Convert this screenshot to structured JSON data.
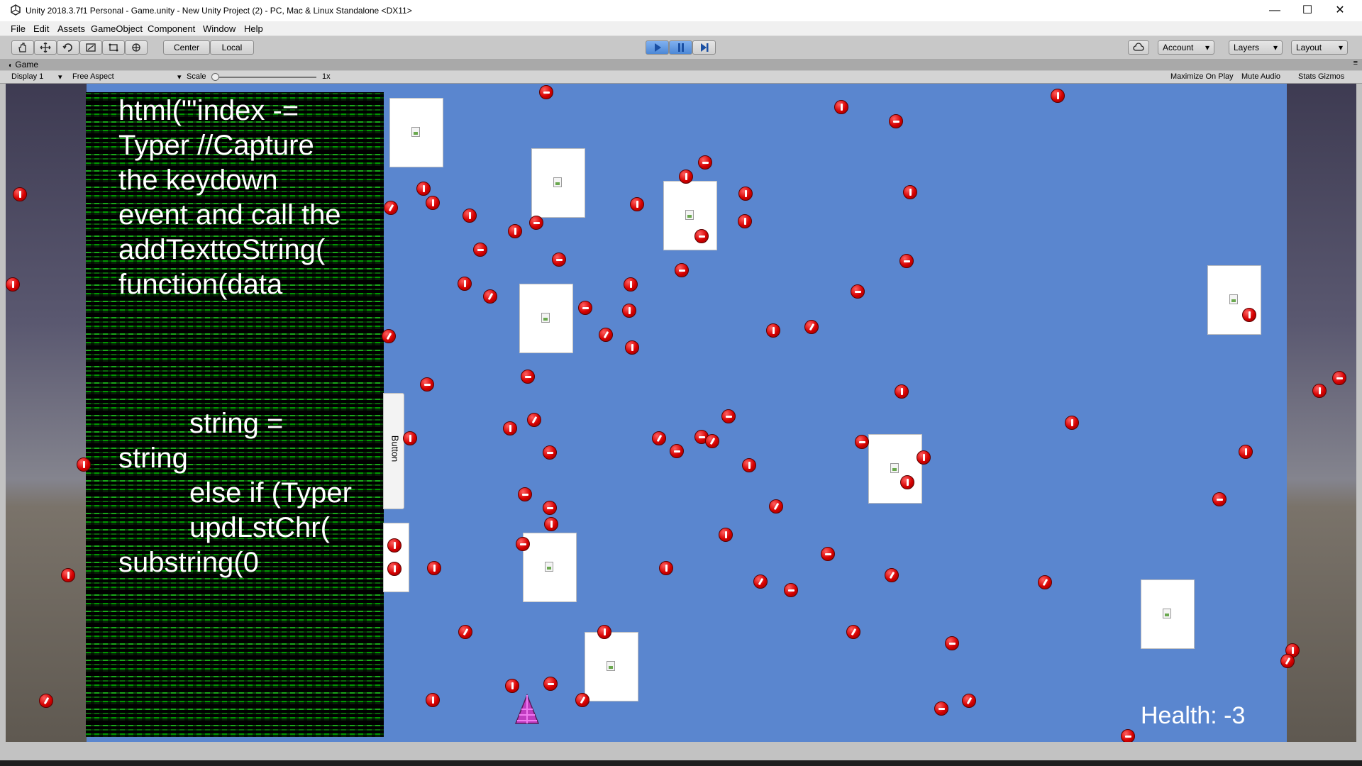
{
  "window": {
    "title": "Unity 2018.3.7f1 Personal - Game.unity - New Unity Project (2) - PC, Mac & Linux Standalone <DX11>",
    "minimize": "—",
    "maximize": "☐",
    "close": "✕"
  },
  "menu": [
    "File",
    "Edit",
    "Assets",
    "GameObject",
    "Component",
    "Window",
    "Help"
  ],
  "toolbar": {
    "tools": [
      "hand-icon",
      "move-icon",
      "rotate-icon",
      "scale-icon",
      "rect-icon",
      "transform-icon"
    ],
    "center_label": "Center",
    "local_label": "Local",
    "account_label": "Account",
    "layers_label": "Layers",
    "layout_label": "Layout"
  },
  "game_tab": {
    "label": "Game"
  },
  "game_bar": {
    "display": "Display 1",
    "aspect": "Free Aspect",
    "scale_label": "Scale",
    "scale_value": "1x",
    "scale_fraction": 0.0,
    "maximize": "Maximize On Play",
    "mute": "Mute Audio",
    "stats": "Stats",
    "gizmos": "Gizmos"
  },
  "game": {
    "code_text": "html(\"'index -=\nTyper //Capture\nthe keydown\nevent and call the\naddTexttoString(\nfunction(data\n\n\n\n         string =\nstring\n         else if (Typer\n         updLstChr(\nsubstring(0",
    "button_label": "Button",
    "health_text": "Health: -3"
  },
  "colors": {
    "game_bg": "#5a86cf",
    "enemy": "#e00000",
    "matrix_green": "#00c800"
  }
}
